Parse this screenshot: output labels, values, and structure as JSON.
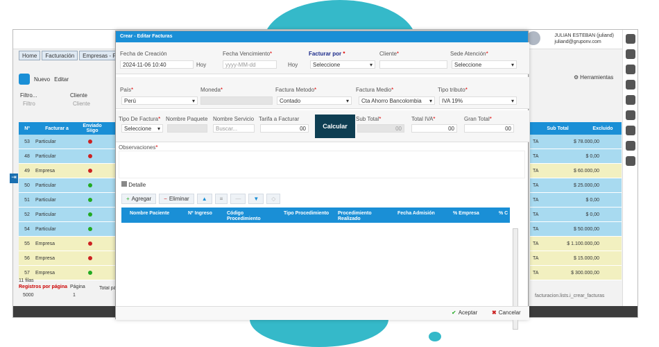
{
  "user": {
    "name": "JULIAN ESTEBAN (juliand)",
    "email": "juliand@gruponv.com"
  },
  "tabs": [
    "Home",
    "Facturación",
    "Empresas - F"
  ],
  "toolbar": {
    "new": "Nuevo",
    "edit": "Editar",
    "tools": "Herramientas"
  },
  "filters": {
    "filter_label": "Filtro...",
    "filter_placeholder": "Filtro",
    "client_label": "Cliente",
    "client_placeholder": "Cliente"
  },
  "grid": {
    "columns_left": [
      "Nº",
      "Facturar a",
      "Enviado Siigo"
    ],
    "columns_right": [
      "Sub Total",
      "Excluido"
    ],
    "rows": [
      {
        "num": "53",
        "type": "Particular",
        "dot": "#c22",
        "cls": "row-blue",
        "sub": "$ 78.000,00"
      },
      {
        "num": "48",
        "type": "Particular",
        "dot": "#c22",
        "cls": "row-blue",
        "sub": "$ 0,00"
      },
      {
        "num": "49",
        "type": "Empresa",
        "dot": "#c22",
        "cls": "row-yellow",
        "sub": "$ 60.000,00"
      },
      {
        "num": "50",
        "type": "Particular",
        "dot": "#2a2",
        "cls": "row-blue",
        "sub": "$ 25.000,00"
      },
      {
        "num": "51",
        "type": "Particular",
        "dot": "#2a2",
        "cls": "row-blue",
        "sub": "$ 0,00"
      },
      {
        "num": "52",
        "type": "Particular",
        "dot": "#2a2",
        "cls": "row-blue",
        "sub": "$ 0,00"
      },
      {
        "num": "54",
        "type": "Particular",
        "dot": "#2a2",
        "cls": "row-blue",
        "sub": "$ 50.000,00"
      },
      {
        "num": "55",
        "type": "Empresa",
        "dot": "#c22",
        "cls": "row-yellow",
        "sub": "$ 1.100.000,00"
      },
      {
        "num": "56",
        "type": "Empresa",
        "dot": "#c22",
        "cls": "row-yellow",
        "sub": "$ 15.000,00"
      },
      {
        "num": "57",
        "type": "Empresa",
        "dot": "#2a2",
        "cls": "row-yellow",
        "sub": "$ 300.000,00"
      }
    ],
    "right_prefix": "TA",
    "rows_count": "11 filas",
    "per_page_label": "Registros por página",
    "per_page_value": "5000",
    "page_label": "Página",
    "page_value": "1",
    "total_label": "Total páginas"
  },
  "breadcrumb_right": "facturacion.lists.i_crear_facturas",
  "dialog": {
    "title": "Crear - Editar Facturas",
    "fecha_creacion_label": "Fecha de Creación",
    "fecha_creacion_value": "2024-11-06 10:40",
    "hoy": "Hoy",
    "fecha_venc_label": "Fecha Vencimiento",
    "fecha_venc_placeholder": "yyyy-MM-dd",
    "facturar_por_label": "Facturar por",
    "facturar_por_value": "Seleccione",
    "cliente_label": "Cliente",
    "sede_label": "Sede Atención",
    "sede_value": "Seleccione",
    "pais_label": "País",
    "pais_value": "Perú",
    "moneda_label": "Moneda",
    "metodo_label": "Factura Metodo",
    "metodo_value": "Contado",
    "medio_label": "Factura Medio",
    "medio_value": "Cta Ahorro Bancolombia",
    "tributo_label": "Tipo tributo",
    "tributo_value": "IVA 19%",
    "tipo_factura_label": "Tipo De Factura",
    "tipo_factura_value": "Seleccione",
    "paquete_label": "Nombre Paquete",
    "servicio_label": "Nombre Servicio",
    "servicio_placeholder": "Buscar...",
    "tarifa_label": "Tarifa a Facturar",
    "tarifa_value": "00",
    "calcular": "Calcular",
    "subtotal_label": "Sub Total",
    "subtotal_value": "00",
    "iva_label": "Total IVA",
    "iva_value": "00",
    "gran_total_label": "Gran Total",
    "gran_total_value": "00",
    "observaciones_label": "Observaciones",
    "detalle_tab": "Detalle",
    "agregar": "Agregar",
    "eliminar": "Eliminar",
    "detail_columns": [
      "Nombre Paciente",
      "Nº Ingreso",
      "Código Procedimiento",
      "Tipo Procedimiento",
      "Procedimiento Realizado",
      "Fecha Admisión",
      "% Empresa",
      "% C"
    ],
    "aceptar": "Aceptar",
    "cancelar": "Cancelar"
  },
  "colors": {
    "primary": "#1a8fd6",
    "calc": "#0e3e52",
    "row_blue": "#a8daf0",
    "row_yellow": "#f2f0c0"
  }
}
